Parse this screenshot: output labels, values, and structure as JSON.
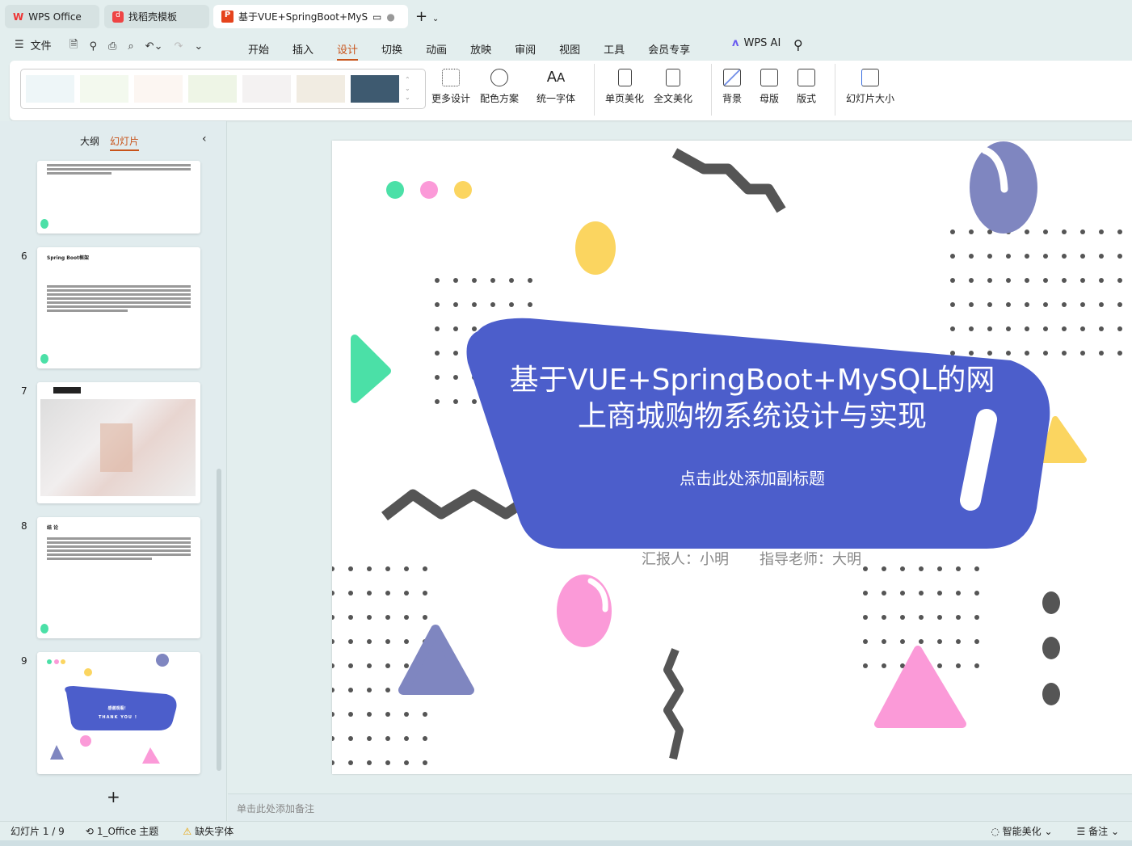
{
  "tabs": [
    {
      "label": "WPS Office",
      "icon": "wps-logo-icon"
    },
    {
      "label": "找稻壳模板",
      "icon": "docer-icon"
    },
    {
      "label": "基于VUE+SpringBoot+MyS(",
      "icon": "presentation-icon"
    }
  ],
  "menu": {
    "file": "文件",
    "items": [
      "开始",
      "插入",
      "设计",
      "切换",
      "动画",
      "放映",
      "审阅",
      "视图",
      "工具",
      "会员专享"
    ],
    "active": "设计",
    "ai": "WPS AI"
  },
  "ribbon": {
    "more_design": "更多设计",
    "color_scheme": "配色方案",
    "unify_font": "统一字体",
    "single_beautify": "单页美化",
    "all_beautify": "全文美化",
    "background": "背景",
    "master": "母版",
    "layout": "版式",
    "slide_size": "幻灯片大小"
  },
  "panel": {
    "outline": "大纲",
    "slides": "幻灯片",
    "thumbs": [
      {
        "num": "6",
        "title": "Spring Boot框架"
      },
      {
        "num": "7",
        "title": ""
      },
      {
        "num": "8",
        "title": "结 论"
      },
      {
        "num": "9",
        "title": "感谢观看！",
        "subtitle": "THANK YOU !"
      }
    ]
  },
  "slide": {
    "title_line1": "基于VUE+SpringBoot+MySQL的网",
    "title_line2": "上商城购物系统设计与实现",
    "subtitle": "点击此处添加副标题",
    "reporter": "汇报人：小明",
    "advisor": "指导老师：大明"
  },
  "notes_placeholder": "单击此处添加备注",
  "status": {
    "slide_count": "幻灯片 1 / 9",
    "theme": "1_Office 主题",
    "missing_font": "缺失字体",
    "smart_beautify": "智能美化",
    "notes": "备注"
  },
  "colors": {
    "accent": "#c8531a",
    "blob": "#4c5ecb",
    "teal": "#4be0a7",
    "pink": "#fb9ad8",
    "yellow": "#fbd560",
    "purple": "#7f86c0",
    "gray": "#555555"
  }
}
